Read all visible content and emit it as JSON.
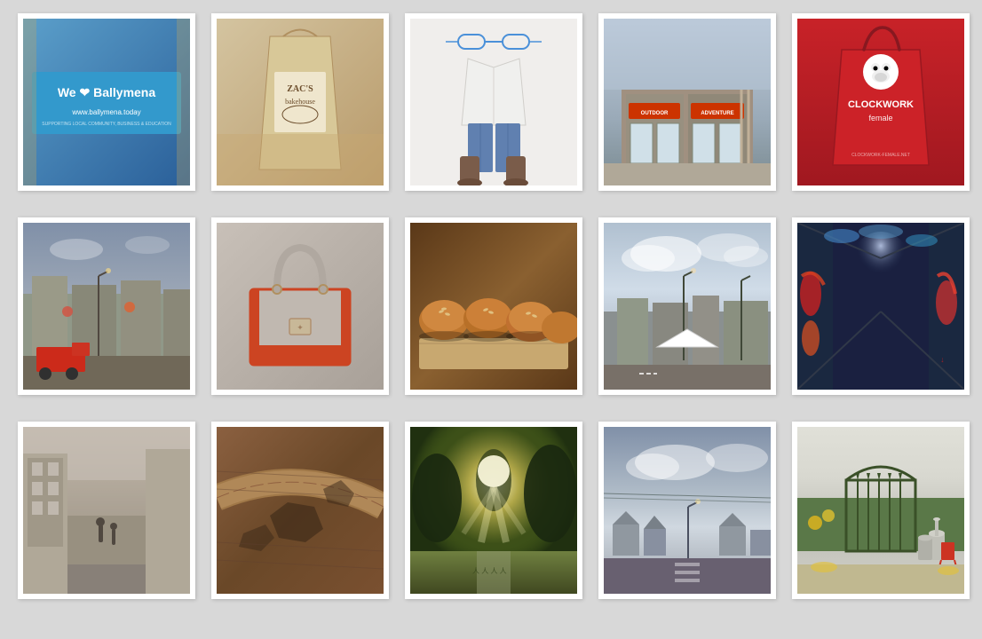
{
  "gallery": {
    "background_color": "#d8d8d8",
    "rows": [
      {
        "id": "row-1",
        "items": [
          {
            "id": "img-1-1",
            "label": "Ballymena sign",
            "theme": "ballymena",
            "alt": "We love Ballymena street sign"
          },
          {
            "id": "img-1-2",
            "label": "Zac's Bakehouse bag",
            "theme": "zacs",
            "alt": "Zac's Bakehouse paper bag"
          },
          {
            "id": "img-1-3",
            "label": "Fashion outfit",
            "theme": "outfit",
            "alt": "White top, jeans, glasses and boots"
          },
          {
            "id": "img-1-4",
            "label": "Outdoor adventure shop",
            "theme": "outdoor",
            "alt": "Outdoor Adventure shop front"
          },
          {
            "id": "img-1-5",
            "label": "Clockwork red bag",
            "theme": "clockwork",
            "alt": "Clockwork female red shopping bag"
          }
        ]
      },
      {
        "id": "row-2",
        "items": [
          {
            "id": "img-2-1",
            "label": "Town street with red truck",
            "theme": "town-street",
            "alt": "Irish town street scene"
          },
          {
            "id": "img-2-2",
            "label": "Grey and red handbag",
            "theme": "handbag",
            "alt": "Grey handbag with red trim"
          },
          {
            "id": "img-2-3",
            "label": "Bread rolls",
            "theme": "bread",
            "alt": "Freshly baked bread rolls on wooden board"
          },
          {
            "id": "img-2-4",
            "label": "Town with cloudy sky",
            "theme": "sky-town",
            "alt": "Town square with cloudy sky"
          },
          {
            "id": "img-2-5",
            "label": "Graffiti tunnel",
            "theme": "tunnel",
            "alt": "Colourful graffiti tunnel"
          }
        ]
      },
      {
        "id": "row-3",
        "items": [
          {
            "id": "img-3-1",
            "label": "Vintage street photo",
            "theme": "vintage-street",
            "alt": "Black and white vintage street"
          },
          {
            "id": "img-3-2",
            "label": "Brick pavement pattern",
            "theme": "pavement",
            "alt": "Decorative brick pavement"
          },
          {
            "id": "img-3-3",
            "label": "Sunny park",
            "theme": "park",
            "alt": "Sunlit park with trees"
          },
          {
            "id": "img-3-4",
            "label": "Road and sky",
            "theme": "road",
            "alt": "Empty road with cloudy sky"
          },
          {
            "id": "img-3-5",
            "label": "Garden gate",
            "theme": "garden",
            "alt": "Green garden gate with milk churns"
          }
        ]
      }
    ]
  }
}
